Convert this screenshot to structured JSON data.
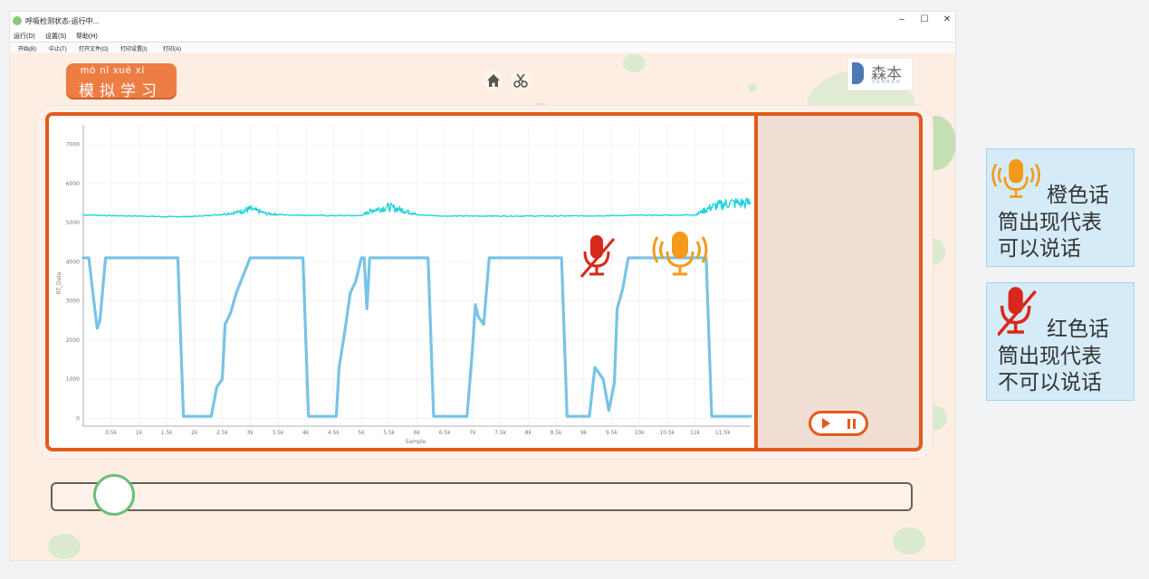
{
  "window": {
    "title": "呼吸检测状态-运行中...",
    "controls": {
      "minimize": "–",
      "maximize": "☐",
      "close": "✕"
    }
  },
  "menu": [
    "运行(D)",
    "设置(S)",
    "帮助(H)"
  ],
  "toolbar": [
    "开始(B)",
    "中止(T)",
    "打开文件(O)",
    "打印设置(I)",
    "打印(A)"
  ],
  "badge": {
    "pinyin": "mó  nǐ  xué  xí",
    "title": "模拟学习"
  },
  "logo": {
    "text": "森本",
    "subtitle": "SENBEN"
  },
  "topbar_icons": [
    "home-icon",
    "scissors-icon"
  ],
  "chart_data": {
    "type": "line",
    "ylabel": "RT_Data",
    "xlabel": "Sample",
    "ylim": [
      -200,
      7500
    ],
    "y_ticks": [
      "0",
      "1000",
      "2000",
      "3000",
      "4000",
      "5000",
      "6000",
      "7000"
    ],
    "x_ticks": [
      "0.5k",
      "1k",
      "1.5k",
      "2k",
      "2.5k",
      "3k",
      "3.5k",
      "4k",
      "4.5k",
      "5k",
      "5.5k",
      "6k",
      "6.5k",
      "7k",
      "7.5k",
      "8k",
      "8.5k",
      "9k",
      "9.5k",
      "10k",
      "10.5k",
      "11k",
      "11.5k"
    ],
    "series": [
      {
        "color": "#22d3dc",
        "x": [
          0,
          500,
          1000,
          1500,
          2000,
          2400,
          2800,
          3000,
          3300,
          3600,
          4000,
          4500,
          5000,
          5200,
          5500,
          5800,
          6000,
          6500,
          7000,
          7500,
          8000,
          8500,
          9000,
          9500,
          10000,
          10500,
          11000,
          11300,
          11600,
          12000
        ],
        "y": [
          5200,
          5180,
          5170,
          5150,
          5160,
          5200,
          5270,
          5350,
          5230,
          5200,
          5190,
          5180,
          5180,
          5320,
          5400,
          5300,
          5200,
          5170,
          5170,
          5170,
          5170,
          5170,
          5175,
          5180,
          5190,
          5190,
          5200,
          5400,
          5500,
          5500
        ]
      },
      {
        "color": "#78c3e6",
        "x": [
          0,
          100,
          180,
          250,
          300,
          400,
          1700,
          1800,
          2300,
          2400,
          2500,
          2550,
          2650,
          2750,
          3000,
          3950,
          4050,
          4550,
          4600,
          4700,
          4800,
          4900,
          5000,
          5050,
          5100,
          5150,
          5200,
          5300,
          6200,
          6300,
          6900,
          7000,
          7050,
          7100,
          7200,
          7300,
          7500,
          8600,
          8700,
          9100,
          9200,
          9350,
          9450,
          9550,
          9600,
          9700,
          9800,
          10000,
          11200,
          11300,
          12000
        ],
        "y": [
          4100,
          4100,
          3100,
          2300,
          2500,
          4100,
          4100,
          50,
          50,
          800,
          1000,
          2400,
          2700,
          3200,
          4100,
          4100,
          50,
          50,
          1300,
          2200,
          3200,
          3500,
          4100,
          4100,
          2800,
          4100,
          4100,
          4100,
          4100,
          50,
          50,
          1800,
          2900,
          2600,
          2400,
          4100,
          4100,
          4100,
          50,
          50,
          1300,
          1000,
          200,
          900,
          2800,
          3300,
          4100,
          4100,
          4100,
          50,
          50
        ]
      }
    ]
  },
  "chart_icons": {
    "muted": "mic-muted-icon",
    "speaking": "mic-speaking-icon"
  },
  "slider": {
    "position": 0.06
  },
  "legend": {
    "orange": {
      "line1": "橙色话",
      "line2": "筒出现代表",
      "line3": "可以说话"
    },
    "red": {
      "line1": "红色话",
      "line2": "筒出现代表",
      "line3": "不可以说话"
    }
  },
  "colors": {
    "accent": "#e35a1c",
    "orange_mic": "#f39a1a",
    "red_mic": "#d8281b",
    "legend_bg": "#d5ebf7"
  }
}
